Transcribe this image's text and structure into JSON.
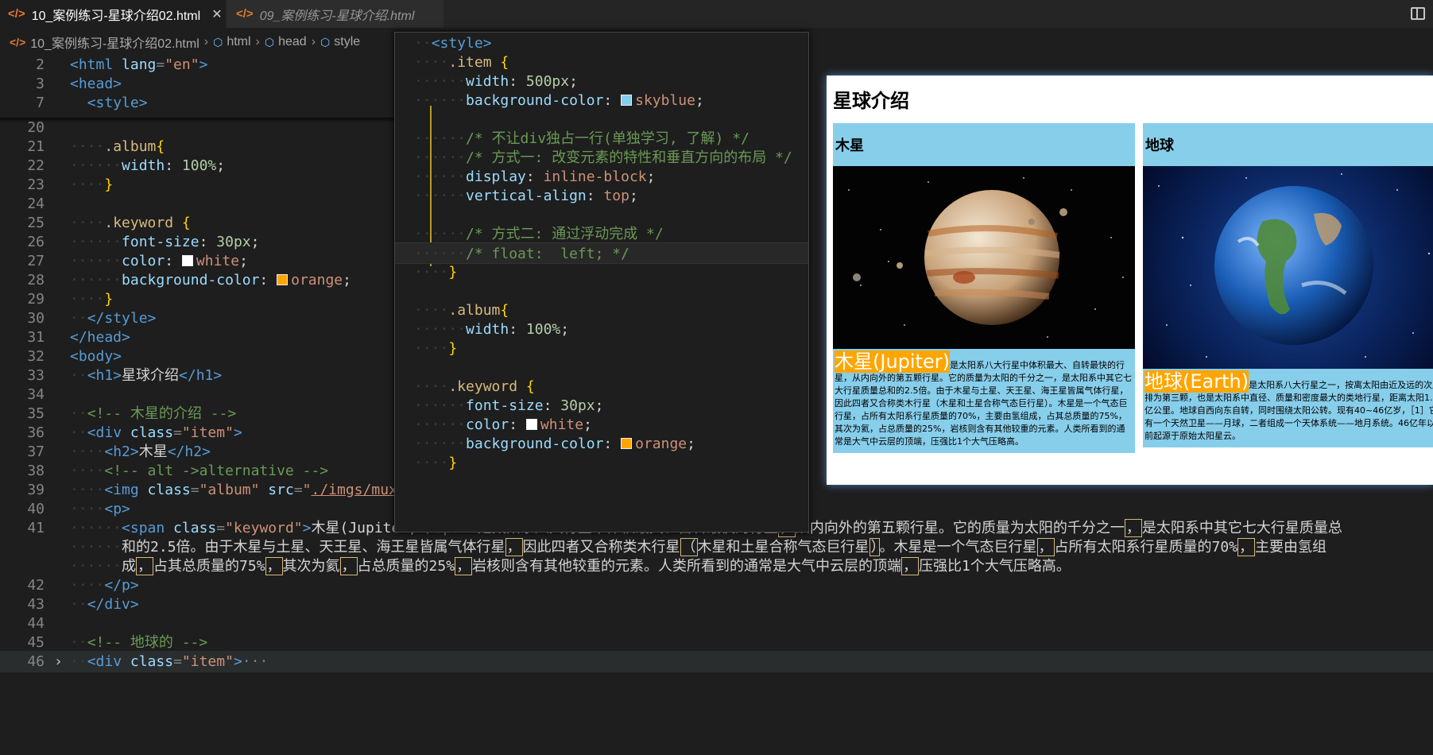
{
  "tabs": [
    {
      "icon": "</>",
      "label": "10_案例练习-星球介绍02.html",
      "close": "✕"
    },
    {
      "icon": "</>",
      "label": "09_案例练习-星球介绍.html"
    }
  ],
  "breadcrumb": {
    "file": "10_案例练习-星球介绍02.html",
    "items": [
      "html",
      "head",
      "style"
    ]
  },
  "editor": {
    "sticky": [
      {
        "num": "2",
        "parts": [
          [
            "tag",
            "<html"
          ],
          [
            "attr",
            " lang"
          ],
          [
            "punc",
            "="
          ],
          [
            "str",
            "\"en\""
          ],
          [
            "tag",
            ">"
          ]
        ]
      },
      {
        "num": "3",
        "parts": [
          [
            "tag",
            "<head>"
          ]
        ]
      },
      {
        "num": "7",
        "parts": [
          [
            "txt",
            "  "
          ],
          [
            "tag",
            "<style>"
          ]
        ]
      }
    ],
    "lines": [
      {
        "num": "20",
        "parts": []
      },
      {
        "num": "21",
        "parts": [
          [
            "dot",
            "····"
          ],
          [
            "sel",
            ".album"
          ],
          [
            "brace",
            "{"
          ]
        ]
      },
      {
        "num": "22",
        "parts": [
          [
            "dot",
            "······"
          ],
          [
            "prop",
            "width"
          ],
          [
            "txt",
            ": "
          ],
          [
            "num",
            "100%"
          ],
          [
            "txt",
            ";"
          ]
        ]
      },
      {
        "num": "23",
        "parts": [
          [
            "dot",
            "····"
          ],
          [
            "brace",
            "}"
          ]
        ]
      },
      {
        "num": "24",
        "parts": []
      },
      {
        "num": "25",
        "parts": [
          [
            "dot",
            "····"
          ],
          [
            "sel",
            ".keyword"
          ],
          [
            "txt",
            " "
          ],
          [
            "brace",
            "{"
          ]
        ]
      },
      {
        "num": "26",
        "parts": [
          [
            "dot",
            "······"
          ],
          [
            "prop",
            "font-size"
          ],
          [
            "txt",
            ": "
          ],
          [
            "num",
            "30px"
          ],
          [
            "txt",
            ";"
          ]
        ]
      },
      {
        "num": "27",
        "parts": [
          [
            "dot",
            "······"
          ],
          [
            "prop",
            "color"
          ],
          [
            "txt",
            ": "
          ],
          [
            "swatch-white",
            ""
          ],
          [
            "val",
            "white"
          ],
          [
            "txt",
            ";"
          ]
        ]
      },
      {
        "num": "28",
        "parts": [
          [
            "dot",
            "······"
          ],
          [
            "prop",
            "background-color"
          ],
          [
            "txt",
            ": "
          ],
          [
            "swatch-orange",
            ""
          ],
          [
            "val",
            "orange"
          ],
          [
            "txt",
            ";"
          ]
        ]
      },
      {
        "num": "29",
        "parts": [
          [
            "dot",
            "····"
          ],
          [
            "brace",
            "}"
          ]
        ]
      },
      {
        "num": "30",
        "parts": [
          [
            "dot",
            "··"
          ],
          [
            "tag",
            "</style>"
          ]
        ]
      },
      {
        "num": "31",
        "parts": [
          [
            "tag",
            "</head>"
          ]
        ]
      },
      {
        "num": "32",
        "parts": [
          [
            "tag",
            "<body>"
          ]
        ]
      },
      {
        "num": "33",
        "parts": [
          [
            "dot",
            "··"
          ],
          [
            "tag",
            "<h1>"
          ],
          [
            "txt",
            "星球介绍"
          ],
          [
            "tag",
            "</h1>"
          ]
        ]
      },
      {
        "num": "34",
        "parts": []
      },
      {
        "num": "35",
        "parts": [
          [
            "dot",
            "··"
          ],
          [
            "com",
            "<!-- 木星的介绍 -->"
          ]
        ]
      },
      {
        "num": "36",
        "parts": [
          [
            "dot",
            "··"
          ],
          [
            "tag",
            "<div"
          ],
          [
            "attr",
            " class"
          ],
          [
            "punc",
            "="
          ],
          [
            "str",
            "\"item\""
          ],
          [
            "tag",
            ">"
          ]
        ]
      },
      {
        "num": "37",
        "parts": [
          [
            "dot",
            "····"
          ],
          [
            "tag",
            "<h2>"
          ],
          [
            "txt",
            "木星"
          ],
          [
            "tag",
            "</h2>"
          ]
        ]
      },
      {
        "num": "38",
        "parts": [
          [
            "dot",
            "····"
          ],
          [
            "com",
            "<!-- alt ->alternative -->"
          ]
        ]
      },
      {
        "num": "39",
        "parts": [
          [
            "dot",
            "····"
          ],
          [
            "tag",
            "<img"
          ],
          [
            "attr",
            " class"
          ],
          [
            "punc",
            "="
          ],
          [
            "str",
            "\"album\""
          ],
          [
            "attr",
            " src"
          ],
          [
            "punc",
            "="
          ],
          [
            "str",
            "\""
          ],
          [
            "link",
            "./imgs/muxing.jpg"
          ],
          [
            "str",
            "\""
          ],
          [
            "attr",
            " alt"
          ],
          [
            "punc",
            "="
          ],
          [
            "str",
            "\"木星\""
          ],
          [
            "tag",
            ">"
          ]
        ]
      },
      {
        "num": "40",
        "parts": [
          [
            "dot",
            "····"
          ],
          [
            "tag",
            "<p>"
          ]
        ]
      },
      {
        "num": "41",
        "parts": [
          [
            "dot",
            "······"
          ],
          [
            "tag",
            "<span"
          ],
          [
            "attr",
            " class"
          ],
          [
            "punc",
            "="
          ],
          [
            "str",
            "\"keyword\""
          ],
          [
            "tag",
            ">"
          ],
          [
            "txt",
            "木星(Jupiter)"
          ],
          [
            "tag",
            "</span>"
          ],
          [
            "txt",
            "是太阳系八大行星中体积最大、自转最快的行星"
          ],
          [
            "box",
            "，"
          ],
          [
            "txt",
            "从内向外的第五颗行星。它的质量为太阳的千分之一"
          ],
          [
            "box",
            "，"
          ],
          [
            "txt",
            "是太阳系中其它七大行星质量总"
          ]
        ]
      },
      {
        "num": "",
        "parts": [
          [
            "dot",
            "······"
          ],
          [
            "txt",
            "和的2.5倍。由于木星与土星、天王星、海王星皆属气体行星"
          ],
          [
            "box",
            "，"
          ],
          [
            "txt",
            "因此四者又合称类木行星"
          ],
          [
            "box",
            "（"
          ],
          [
            "txt",
            "木星和土星合称气态巨行星"
          ],
          [
            "box",
            "）"
          ],
          [
            "txt",
            "。木星是一个气态巨行星"
          ],
          [
            "box",
            "，"
          ],
          [
            "txt",
            "占所有太阳系行星质量的70%"
          ],
          [
            "box",
            "，"
          ],
          [
            "txt",
            "主要由氢组"
          ]
        ]
      },
      {
        "num": "",
        "parts": [
          [
            "dot",
            "······"
          ],
          [
            "txt",
            "成"
          ],
          [
            "box",
            "，"
          ],
          [
            "txt",
            "占其总质量的75%"
          ],
          [
            "box",
            "，"
          ],
          [
            "txt",
            "其次为氦"
          ],
          [
            "box",
            "，"
          ],
          [
            "txt",
            "占总质量的25%"
          ],
          [
            "box",
            "，"
          ],
          [
            "txt",
            "岩核则含有其他较重的元素。人类所看到的通常是大气中云层的顶端"
          ],
          [
            "box",
            "，"
          ],
          [
            "txt",
            "压强比1个大气压略高。"
          ]
        ]
      },
      {
        "num": "42",
        "parts": [
          [
            "dot",
            "····"
          ],
          [
            "tag",
            "</p>"
          ]
        ]
      },
      {
        "num": "43",
        "parts": [
          [
            "dot",
            "··"
          ],
          [
            "tag",
            "</div>"
          ]
        ]
      },
      {
        "num": "44",
        "parts": []
      },
      {
        "num": "45",
        "parts": [
          [
            "dot",
            "··"
          ],
          [
            "com",
            "<!-- 地球的 -->"
          ]
        ]
      },
      {
        "num": "46",
        "fold": "›",
        "parts": [
          [
            "dot",
            "··"
          ],
          [
            "tag",
            "<div"
          ],
          [
            "attr",
            " class"
          ],
          [
            "punc",
            "="
          ],
          [
            "str",
            "\"item\""
          ],
          [
            "tag",
            ">"
          ],
          [
            "punc",
            "···"
          ]
        ]
      }
    ]
  },
  "peek": {
    "lines": [
      {
        "parts": [
          [
            "dot",
            "··"
          ],
          [
            "tag",
            "<style>"
          ]
        ]
      },
      {
        "parts": [
          [
            "dot",
            "····"
          ],
          [
            "sel",
            ".item"
          ],
          [
            "txt",
            " "
          ],
          [
            "brace",
            "{"
          ]
        ]
      },
      {
        "parts": [
          [
            "dot",
            "······"
          ],
          [
            "prop",
            "width"
          ],
          [
            "txt",
            ": "
          ],
          [
            "num",
            "500px"
          ],
          [
            "txt",
            ";"
          ]
        ]
      },
      {
        "parts": [
          [
            "dot",
            "······"
          ],
          [
            "prop",
            "background-color"
          ],
          [
            "txt",
            ": "
          ],
          [
            "swatch-skyblue",
            ""
          ],
          [
            "val",
            "skyblue"
          ],
          [
            "txt",
            ";"
          ]
        ]
      },
      {
        "parts": []
      },
      {
        "parts": [
          [
            "dot",
            "······"
          ],
          [
            "com",
            "/* 不让div独占一行(单独学习, 了解) */"
          ]
        ]
      },
      {
        "parts": [
          [
            "dot",
            "······"
          ],
          [
            "com",
            "/* 方式一: 改变元素的特性和垂直方向的布局 */"
          ]
        ]
      },
      {
        "parts": [
          [
            "dot",
            "······"
          ],
          [
            "prop",
            "display"
          ],
          [
            "txt",
            ": "
          ],
          [
            "val",
            "inline-block"
          ],
          [
            "txt",
            ";"
          ]
        ]
      },
      {
        "parts": [
          [
            "dot",
            "······"
          ],
          [
            "prop",
            "vertical-align"
          ],
          [
            "txt",
            ": "
          ],
          [
            "val",
            "top"
          ],
          [
            "txt",
            ";"
          ]
        ]
      },
      {
        "parts": []
      },
      {
        "parts": [
          [
            "dot",
            "······"
          ],
          [
            "com",
            "/* 方式二: 通过浮动完成 */"
          ]
        ]
      },
      {
        "parts": [
          [
            "dot",
            "······"
          ],
          [
            "com",
            "/* float:  left; */"
          ]
        ]
      },
      {
        "parts": [
          [
            "dot",
            "····"
          ],
          [
            "brace",
            "}"
          ]
        ]
      },
      {
        "parts": []
      },
      {
        "parts": [
          [
            "dot",
            "····"
          ],
          [
            "sel",
            ".album"
          ],
          [
            "brace",
            "{"
          ]
        ]
      },
      {
        "parts": [
          [
            "dot",
            "······"
          ],
          [
            "prop",
            "width"
          ],
          [
            "txt",
            ": "
          ],
          [
            "num",
            "100%"
          ],
          [
            "txt",
            ";"
          ]
        ]
      },
      {
        "parts": [
          [
            "dot",
            "····"
          ],
          [
            "brace",
            "}"
          ]
        ]
      },
      {
        "parts": []
      },
      {
        "parts": [
          [
            "dot",
            "····"
          ],
          [
            "sel",
            ".keyword"
          ],
          [
            "txt",
            " "
          ],
          [
            "brace",
            "{"
          ]
        ]
      },
      {
        "parts": [
          [
            "dot",
            "······"
          ],
          [
            "prop",
            "font-size"
          ],
          [
            "txt",
            ": "
          ],
          [
            "num",
            "30px"
          ],
          [
            "txt",
            ";"
          ]
        ]
      },
      {
        "parts": [
          [
            "dot",
            "······"
          ],
          [
            "prop",
            "color"
          ],
          [
            "txt",
            ": "
          ],
          [
            "swatch-white",
            ""
          ],
          [
            "val",
            "white"
          ],
          [
            "txt",
            ";"
          ]
        ]
      },
      {
        "parts": [
          [
            "dot",
            "······"
          ],
          [
            "prop",
            "background-color"
          ],
          [
            "txt",
            ": "
          ],
          [
            "swatch-orange",
            ""
          ],
          [
            "val",
            "orange"
          ],
          [
            "txt",
            ";"
          ]
        ]
      },
      {
        "parts": [
          [
            "dot",
            "····"
          ],
          [
            "brace",
            "}"
          ]
        ]
      }
    ]
  },
  "preview": {
    "title": "星球介绍",
    "items": [
      {
        "heading": "木星",
        "image_alt": "木星",
        "keyword": "木星(Jupiter)",
        "text": "是太阳系八大行星中体积最大、自转最快的行星，从内向外的第五颗行星。它的质量为太阳的千分之一，是太阳系中其它七大行星质量总和的2.5倍。由于木星与土星、天王星、海王星皆属气体行星，因此四者又合称类木行星（木星和土星合称气态巨行星）。木星是一个气态巨行星，占所有太阳系行星质量的70%，主要由氢组成，占其总质量的75%，其次为氦，占总质量的25%，岩核则含有其他较重的元素。人类所看到的通常是大气中云层的顶端，压强比1个大气压略高。"
      },
      {
        "heading": "地球",
        "image_alt": "地球",
        "keyword": "地球(Earth)",
        "text": "是太阳系八大行星之一，按离太阳由近及远的次序排为第三颗，也是太阳系中直径、质量和密度最大的类地行星，距离太阳1.5亿公里。地球自西向东自转，同时围绕太阳公转。现有40~46亿岁，［1］它有一个天然卫星——月球，二者组成一个天体系统——地月系统。46亿年以前起源于原始太阳星云。"
      }
    ]
  },
  "colors": {
    "skyblue": "#87ceeb",
    "orange": "#ffa500",
    "white": "#ffffff",
    "html_icon": "#e37933"
  }
}
